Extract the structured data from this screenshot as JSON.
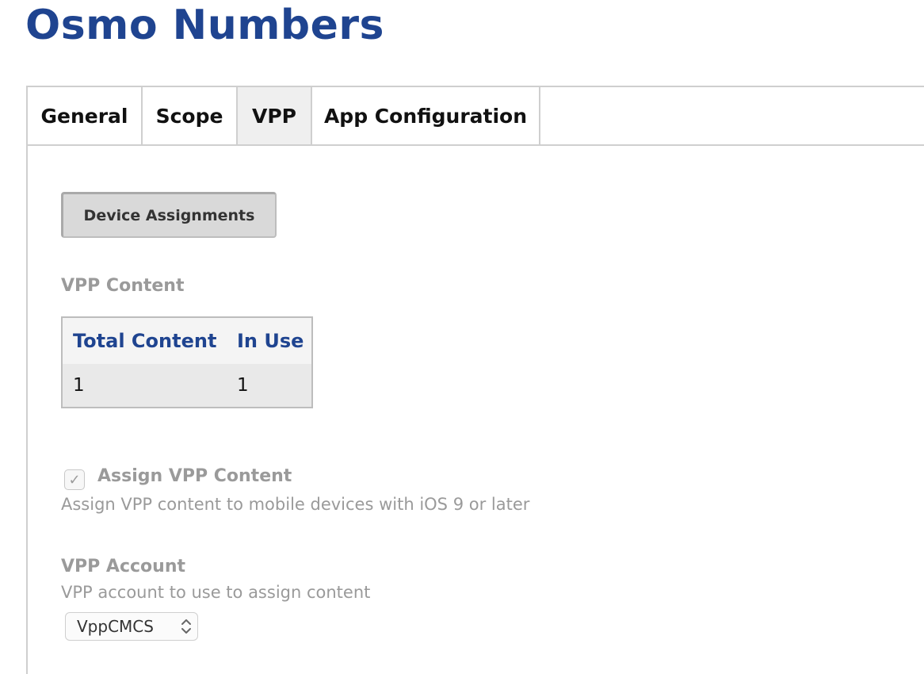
{
  "app": {
    "title": "Osmo Numbers"
  },
  "tabs": [
    {
      "label": "General",
      "active": false
    },
    {
      "label": "Scope",
      "active": false
    },
    {
      "label": "VPP",
      "active": true
    },
    {
      "label": "App Configuration",
      "active": false
    }
  ],
  "subtabs": {
    "device_assignments_label": "Device Assignments"
  },
  "vpp_content": {
    "label": "VPP Content",
    "columns": [
      "Total Content",
      "In Use"
    ],
    "rows": [
      [
        "1",
        "1"
      ]
    ]
  },
  "assign_vpp": {
    "label": "Assign VPP Content",
    "checked": true,
    "check_glyph": "✓",
    "description": "Assign VPP content to mobile devices with iOS 9 or later"
  },
  "vpp_account": {
    "label": "VPP Account",
    "description": "VPP account to use to assign content",
    "selected": "VppCMCS"
  },
  "colors": {
    "title": "#1f4490",
    "table_header": "#1f4490",
    "muted_text": "#9a9a9a",
    "active_tab_bg": "#efefef"
  }
}
